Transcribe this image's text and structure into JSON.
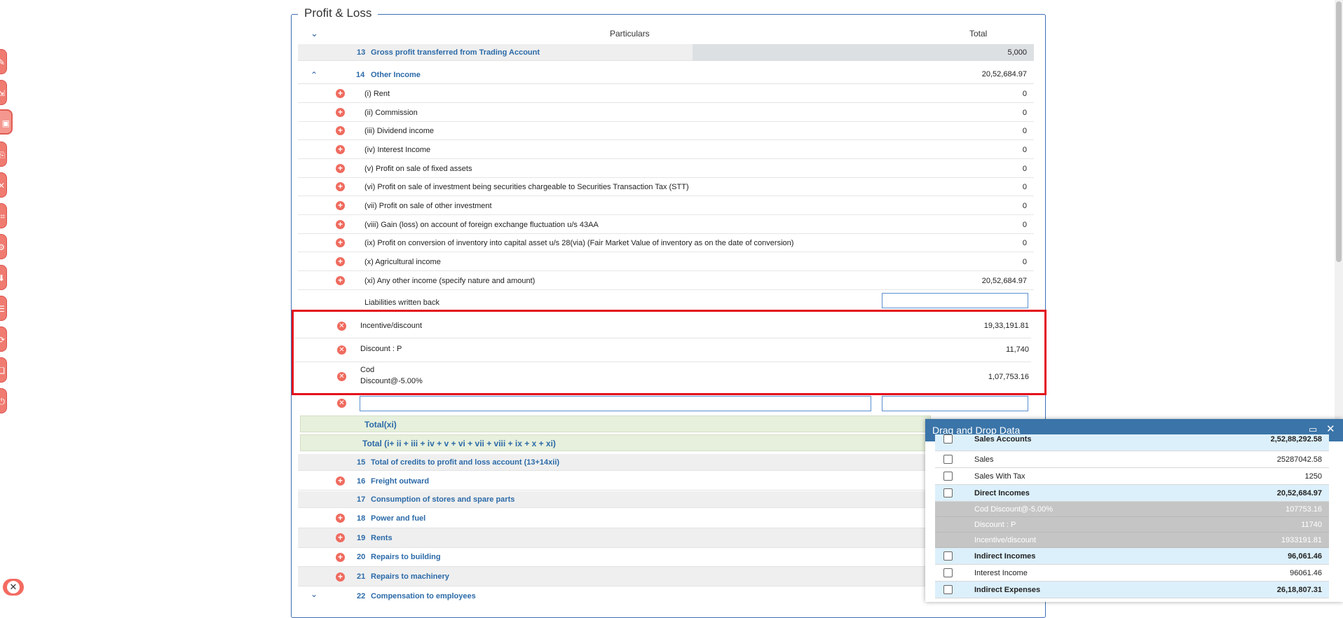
{
  "panel": {
    "title": "Profit & Loss"
  },
  "table": {
    "col_particulars": "Particulars",
    "col_total": "Total"
  },
  "row13": {
    "num": "13",
    "label": "Gross profit transferred from Trading Account",
    "total": "5,000"
  },
  "row14": {
    "num": "14",
    "label": "Other Income",
    "total": "20,52,684.97"
  },
  "other_income_items": [
    {
      "label": "(i) Rent",
      "value": "0"
    },
    {
      "label": "(ii) Commission",
      "value": "0"
    },
    {
      "label": "(iii) Dividend income",
      "value": "0"
    },
    {
      "label": "(iv) Interest Income",
      "value": "0"
    },
    {
      "label": "(v) Profit on sale of fixed assets",
      "value": "0"
    },
    {
      "label": "(vi) Profit on sale of investment being securities chargeable to Securities Transaction Tax (STT)",
      "value": "0"
    },
    {
      "label": "(vii) Profit on sale of other investment",
      "value": "0"
    },
    {
      "label": "(viii) Gain (loss) on account of foreign exchange fluctuation u/s 43AA",
      "value": "0"
    },
    {
      "label": "(ix) Profit on conversion of inventory into capital asset u/s 28(via) (Fair Market Value of inventory as on the date of conversion)",
      "value": "0"
    },
    {
      "label": "(x) Agricultural income",
      "value": "0"
    },
    {
      "label": "(xi) Any other income (specify nature and amount)",
      "value": "20,52,684.97"
    }
  ],
  "liabilities_label": "Liabilities written back",
  "xi_entries": [
    {
      "label": "Incentive/discount",
      "value": "19,33,191.81"
    },
    {
      "label": "Discount : P",
      "value": "11,740"
    },
    {
      "label": "Cod",
      "label2": "Discount@-5.00%",
      "value": "1,07,753.16"
    }
  ],
  "totals": {
    "total_xi": "Total(xi)",
    "total_all": "Total (i+ ii + iii + iv + v + vi + vii + viii + ix + x + xi)"
  },
  "lower_rows": [
    {
      "num": "15",
      "label": "Total of credits to profit and loss account (13+14xii)"
    },
    {
      "num": "16",
      "label": "Freight outward"
    },
    {
      "num": "17",
      "label": "Consumption of stores and spare parts"
    },
    {
      "num": "18",
      "label": "Power and fuel"
    },
    {
      "num": "19",
      "label": "Rents"
    },
    {
      "num": "20",
      "label": "Repairs to building"
    },
    {
      "num": "21",
      "label": "Repairs to machinery"
    },
    {
      "num": "22",
      "label": "Compensation to employees"
    }
  ],
  "dragdrop": {
    "title": "Drag and Drop Data",
    "rows": [
      {
        "name": "Sales Accounts",
        "amount": "2,52,88,292.58",
        "kind": "group"
      },
      {
        "name": "Sales",
        "amount": "25287042.58",
        "kind": "plain"
      },
      {
        "name": "Sales With Tax",
        "amount": "1250",
        "kind": "plain"
      },
      {
        "name": "Direct Incomes",
        "amount": "20,52,684.97",
        "kind": "group"
      },
      {
        "name": "Cod Discount@-5.00%",
        "amount": "107753.16",
        "kind": "sel"
      },
      {
        "name": "Discount : P",
        "amount": "11740",
        "kind": "sel"
      },
      {
        "name": "Incentive/discount",
        "amount": "1933191.81",
        "kind": "sel"
      },
      {
        "name": "Indirect Incomes",
        "amount": "96,061.46",
        "kind": "group"
      },
      {
        "name": "Interest Income",
        "amount": "96061.46",
        "kind": "plain"
      },
      {
        "name": "Indirect Expenses",
        "amount": "26,18,807.31",
        "kind": "group"
      }
    ]
  },
  "icons": {
    "add": "plus-circle-icon",
    "remove": "x-circle-icon",
    "collapse": "chevron-up-icon",
    "expand": "chevron-down-icon"
  },
  "colors": {
    "accent": "#2b6aa8",
    "add_button": "#ef6b5e",
    "highlight_border": "#e3101b",
    "dd_header": "#3a74a8"
  }
}
